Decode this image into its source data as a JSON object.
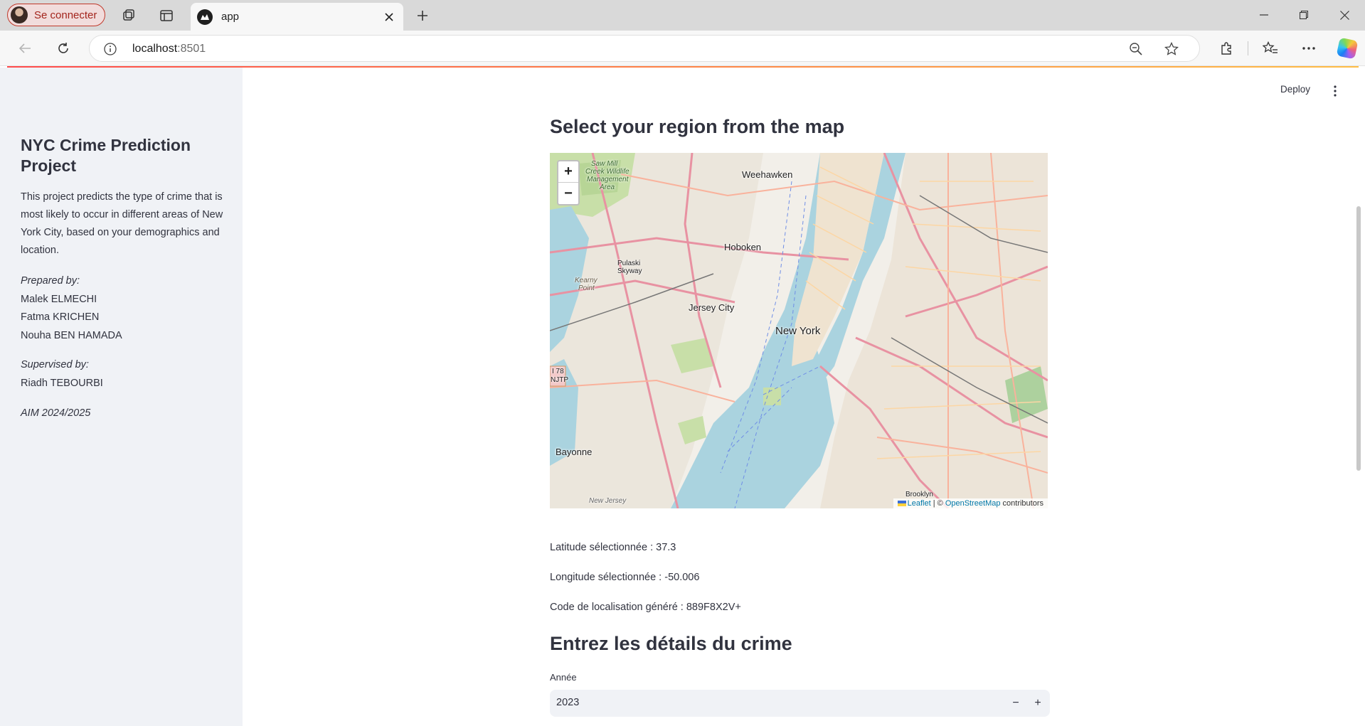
{
  "browser": {
    "profile_label": "Se connecter",
    "tab_title": "app",
    "url_host": "localhost",
    "url_port": ":8501"
  },
  "sidebar": {
    "title": "NYC Crime Prediction Project",
    "description": "This project predicts the type of crime that is most likely to occur in different areas of New York City, based on your demographics and location.",
    "prepared_by_label": "Prepared by:",
    "authors": [
      "Malek ELMECHI",
      "Fatma KRICHEN",
      "Nouha BEN HAMADA"
    ],
    "supervised_by_label": "Supervised by:",
    "supervisor": "Riadh TEBOURBI",
    "year": "AIM 2024/2025"
  },
  "header": {
    "deploy_label": "Deploy"
  },
  "map_section": {
    "title": "Select your region from the map",
    "zoom_in": "+",
    "zoom_out": "−",
    "labels": {
      "weehawken": "Weehawken",
      "hoboken": "Hoboken",
      "jersey_city": "Jersey City",
      "new_york": "New York",
      "bayonne": "Bayonne",
      "pulaski_1": "Pulaski",
      "pulaski_2": "Skyway",
      "kearny_1": "Kearny",
      "kearny_2": "Point",
      "sawmill_1": "Saw Mill",
      "sawmill_2": "Creek Wildlife",
      "sawmill_3": "Management",
      "sawmill_4": "Area",
      "brooklyn": "Brooklyn",
      "new_jersey": "New Jersey",
      "njtp_1": "I 78",
      "njtp_2": "NJTP"
    },
    "attribution": {
      "leaflet": "Leaflet",
      "sep": " | © ",
      "osm": "OpenStreetMap",
      "contributors": " contributors"
    }
  },
  "location": {
    "latitude_text": "Latitude sélectionnée : 37.3",
    "longitude_text": "Longitude sélectionnée : -50.006",
    "code_text": "Code de localisation généré : 889F8X2V+"
  },
  "crime_form": {
    "title": "Entrez les détails du crime",
    "year_label": "Année",
    "year_value": "2023",
    "minus_label": "−",
    "plus_label": "+"
  },
  "colors": {
    "streamlit_accent": "#ff4b4b",
    "sidebar_bg": "#f0f2f6",
    "text": "#31333f",
    "water": "#aad3df"
  }
}
